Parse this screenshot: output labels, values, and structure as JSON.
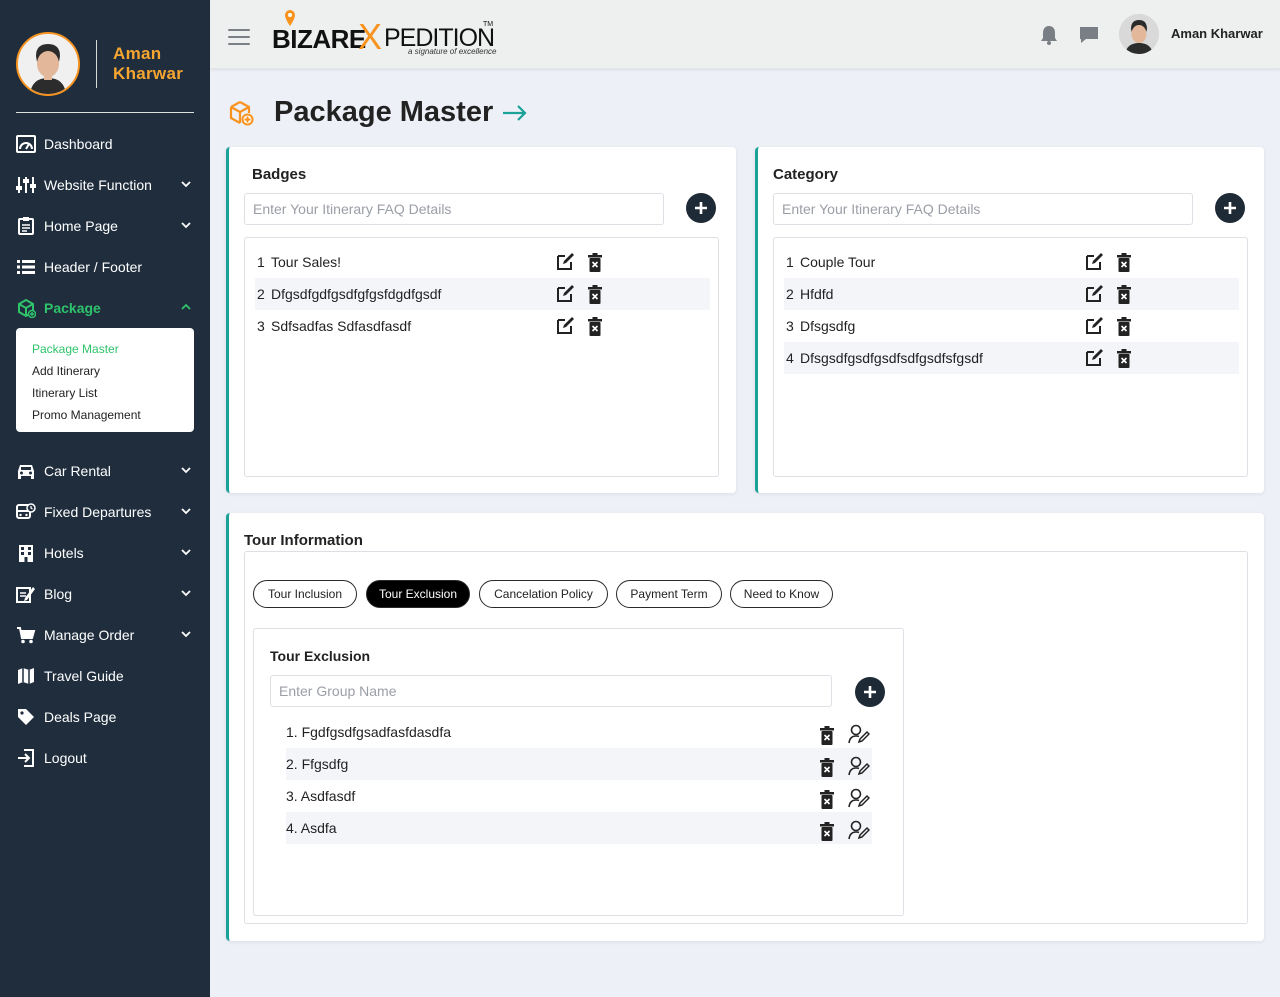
{
  "user": {
    "first_name": "Aman",
    "last_name": "Kharwar",
    "full_name": "Aman Kharwar"
  },
  "brand": {
    "bizare": "BIZARE",
    "x": "X",
    "pedition": "PEDITION",
    "tm": "TM",
    "tagline": "a signature of excellence",
    "accent": "#f7931e"
  },
  "sidebar": {
    "items": [
      {
        "label": "Dashboard",
        "icon": "dashboard-gauge-icon",
        "has_chevron": false
      },
      {
        "label": "Website Function",
        "icon": "sliders-icon",
        "has_chevron": true
      },
      {
        "label": "Home Page",
        "icon": "clipboard-icon",
        "has_chevron": true
      },
      {
        "label": "Header / Footer",
        "icon": "list-icon",
        "has_chevron": false
      },
      {
        "label": "Package",
        "icon": "package-icon",
        "has_chevron": true,
        "active": true
      },
      {
        "label": "Car Rental",
        "icon": "car-icon",
        "has_chevron": true
      },
      {
        "label": "Fixed Departures",
        "icon": "bus-icon",
        "has_chevron": true
      },
      {
        "label": "Hotels",
        "icon": "building-icon",
        "has_chevron": true
      },
      {
        "label": "Blog",
        "icon": "edit-document-icon",
        "has_chevron": true
      },
      {
        "label": "Manage Order",
        "icon": "cart-icon",
        "has_chevron": true
      },
      {
        "label": "Travel Guide",
        "icon": "map-icon",
        "has_chevron": false
      },
      {
        "label": "Deals Page",
        "icon": "tag-icon",
        "has_chevron": false
      },
      {
        "label": "Logout",
        "icon": "logout-icon",
        "has_chevron": false
      }
    ],
    "package_submenu": [
      "Package Master",
      "Add Itinerary",
      "Itinerary List",
      "Promo Management"
    ],
    "active_color": "#2fc36b"
  },
  "page": {
    "title": "Package Master"
  },
  "badges": {
    "title": "Badges",
    "placeholder": "Enter Your Itinerary FAQ Details",
    "items": [
      {
        "num": "1",
        "text": "Tour Sales!"
      },
      {
        "num": "2",
        "text": "Dfgsdfgdfgsdfgfgsfdgdfgsdf"
      },
      {
        "num": "3",
        "text": "Sdfsadfas Sdfasdfasdf"
      }
    ]
  },
  "category": {
    "title": "Category",
    "placeholder": "Enter Your Itinerary FAQ Details",
    "items": [
      {
        "num": "1",
        "text": "Couple Tour"
      },
      {
        "num": "2",
        "text": "Hfdfd"
      },
      {
        "num": "3",
        "text": "Dfsgsdfg"
      },
      {
        "num": "4",
        "text": "Dfsgsdfgsdfgsdfsdfgsdfsfgsdf"
      }
    ]
  },
  "tour_info": {
    "title": "Tour Information",
    "tabs": [
      "Tour Inclusion",
      "Tour Exclusion",
      "Cancelation Policy",
      "Payment Term",
      "Need to Know"
    ],
    "active_tab": "Tour Exclusion",
    "panel_title": "Tour Exclusion",
    "placeholder": "Enter Group Name",
    "items": [
      "1. Fgdfgsdfgsadfasfdasdfa",
      "2. Ffgsdfg",
      "3. Asdfasdf",
      "4. Asdfa"
    ]
  },
  "accent_teal": "#1aa198"
}
